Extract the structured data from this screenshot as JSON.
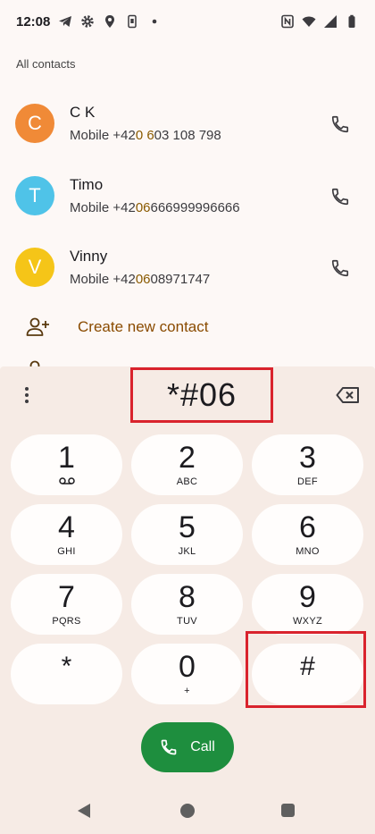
{
  "status_bar": {
    "time": "12:08",
    "left_icons": [
      "telegram-icon",
      "gear-icon",
      "location-icon",
      "phone-sim-icon",
      "dot-icon"
    ],
    "right_icons": [
      "nfc-icon",
      "wifi-icon",
      "signal-icon",
      "battery-icon"
    ]
  },
  "contacts_section": {
    "label": "All contacts",
    "contacts": [
      {
        "initial": "C",
        "name": "C K",
        "number_prefix": "Mobile +42",
        "number_highlight": "0 6",
        "number_suffix": "03 108 798",
        "avatar_color": "#f08a37"
      },
      {
        "initial": "T",
        "name": "Timo",
        "number_prefix": "Mobile +42",
        "number_highlight": "06",
        "number_suffix": "666999996666",
        "avatar_color": "#4fc3e8"
      },
      {
        "initial": "V",
        "name": "Vinny",
        "number_prefix": "Mobile +42",
        "number_highlight": "06",
        "number_suffix": "08971747",
        "avatar_color": "#f5c518"
      }
    ],
    "create_new_label": "Create new contact"
  },
  "dialpad": {
    "digits": "*#06",
    "keys": [
      {
        "num": "1",
        "sub": ""
      },
      {
        "num": "2",
        "sub": "ABC"
      },
      {
        "num": "3",
        "sub": "DEF"
      },
      {
        "num": "4",
        "sub": "GHI"
      },
      {
        "num": "5",
        "sub": "JKL"
      },
      {
        "num": "6",
        "sub": "MNO"
      },
      {
        "num": "7",
        "sub": "PQRS"
      },
      {
        "num": "8",
        "sub": "TUV"
      },
      {
        "num": "9",
        "sub": "WXYZ"
      },
      {
        "num": "*",
        "sub": ""
      },
      {
        "num": "0",
        "sub": "+"
      },
      {
        "num": "#",
        "sub": ""
      }
    ],
    "call_label": "Call"
  },
  "colors": {
    "accent_green": "#1e8e3e",
    "highlight_red": "#d9232d",
    "create_contact": "#8a4b00"
  }
}
